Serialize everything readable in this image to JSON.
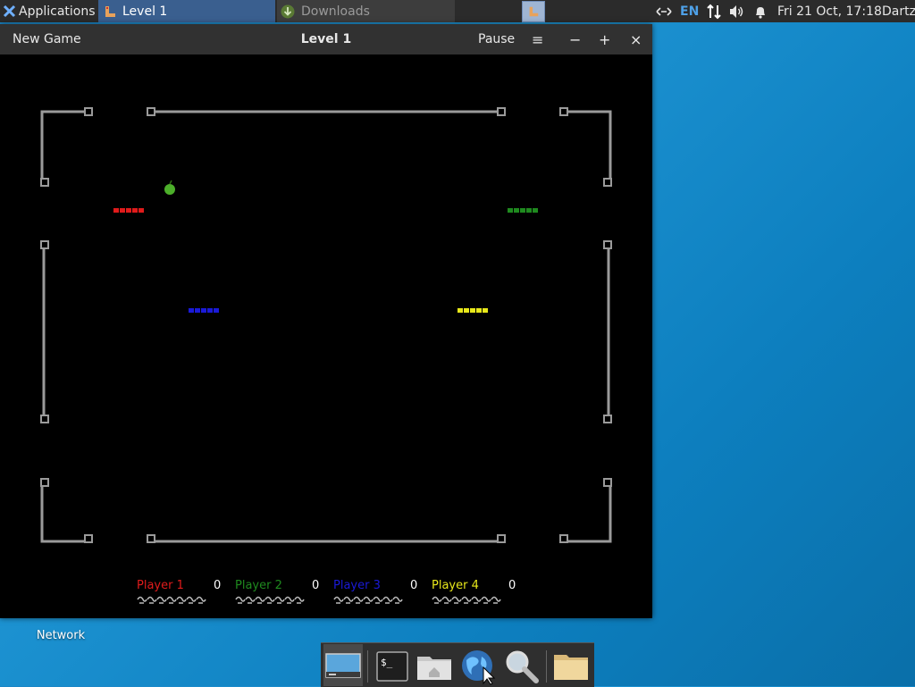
{
  "top_panel": {
    "applications_label": "Applications",
    "tasks": [
      {
        "label": "Level 1",
        "active": true
      },
      {
        "label": "Downloads",
        "active": false
      }
    ],
    "language": "EN",
    "clock": "Fri 21 Oct, 17:18",
    "user": "Dartz",
    "icons": [
      "xfce-logo-icon",
      "game-icon",
      "downloads-icon",
      "network-arrows-icon",
      "transfer-icon",
      "volume-icon",
      "bell-icon"
    ]
  },
  "window": {
    "title": "Level 1",
    "new_game_label": "New Game",
    "pause_label": "Pause",
    "menu_icon": "≡",
    "minimize_icon": "−",
    "maximize_icon": "+",
    "close_icon": "×"
  },
  "game": {
    "background": "#000000",
    "wall_color": "#9a9a9a",
    "apple_color": "#4caf2a",
    "players": [
      {
        "name": "Player 1",
        "score": "0",
        "color": "#e01b1b",
        "lives": 7
      },
      {
        "name": "Player 2",
        "score": "0",
        "color": "#1f8a1f",
        "lives": 7
      },
      {
        "name": "Player 3",
        "score": "0",
        "color": "#1a1ad8",
        "lives": 7
      },
      {
        "name": "Player 4",
        "score": "0",
        "color": "#e8e81a",
        "lives": 7
      }
    ]
  },
  "desktop": {
    "network_label": "Network"
  },
  "dock": {
    "icons": [
      "show-desktop-icon",
      "terminal-icon",
      "home-folder-icon",
      "web-browser-icon",
      "search-icon",
      "files-icon"
    ]
  }
}
